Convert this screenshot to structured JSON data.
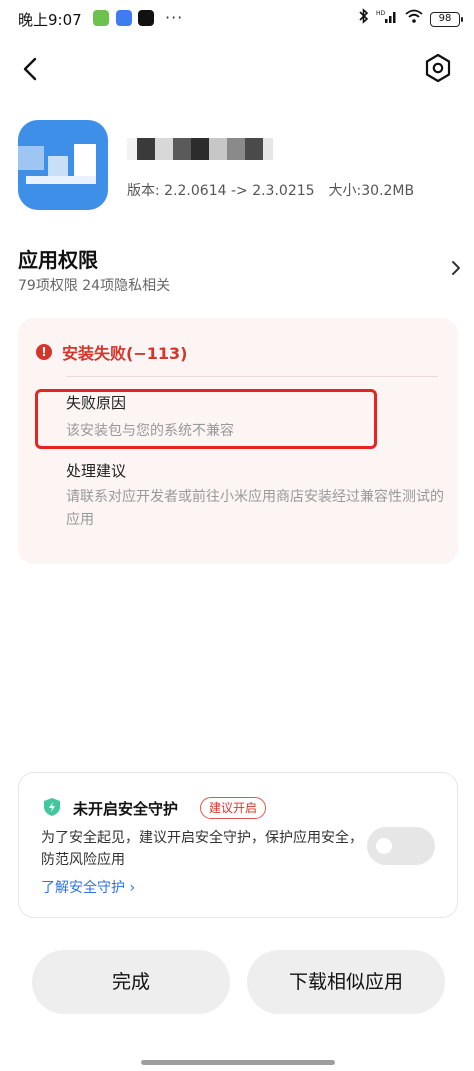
{
  "status_bar": {
    "time": "晚上9:07",
    "more": "···",
    "network": "HD",
    "battery": "98"
  },
  "app": {
    "version_label": "版本: 2.2.0614 -> 2.3.0215",
    "size_label": "大小:30.2MB"
  },
  "permissions": {
    "title": "应用权限",
    "subtitle": "79项权限 24项隐私相关"
  },
  "error": {
    "title": "安装失败(−113)",
    "reason_label": "失败原因",
    "reason_text": "该安装包与您的系统不兼容",
    "advice_label": "处理建议",
    "advice_text": "请联系对应开发者或前往小米应用商店安装经过兼容性测试的应用"
  },
  "security": {
    "title": "未开启安全守护",
    "badge": "建议开启",
    "description": "为了安全起见，建议开启安全守护，保护应用安全，防范风险应用",
    "link": "了解安全守护",
    "enabled": false
  },
  "buttons": {
    "done": "完成",
    "download_similar": "下载相似应用"
  },
  "colors": {
    "error_red": "#d6352b",
    "link_blue": "#2f73e6",
    "app_icon_blue": "#3e8fe8",
    "shield_green": "#43c59e"
  }
}
